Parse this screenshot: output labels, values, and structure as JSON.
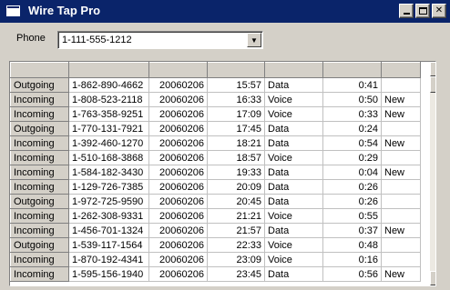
{
  "window": {
    "title": "Wire Tap Pro",
    "icons": {
      "minimize": "minimize-icon",
      "maximize": "maximize-icon",
      "close": "close-icon",
      "close_glyph": "✕"
    }
  },
  "phone": {
    "label": "Phone",
    "value": "1-111-555-1212",
    "dropdown_glyph": "▼"
  },
  "grid": {
    "headers": [
      "",
      "",
      "",
      "",
      "",
      "",
      ""
    ],
    "rows": [
      {
        "dir": "Outgoing",
        "number": "1-862-890-4662",
        "date": "20060206",
        "time": "15:57",
        "type": "Data",
        "duration": "0:41",
        "flag": ""
      },
      {
        "dir": "Incoming",
        "number": "1-808-523-2118",
        "date": "20060206",
        "time": "16:33",
        "type": "Voice",
        "duration": "0:50",
        "flag": "New"
      },
      {
        "dir": "Incoming",
        "number": "1-763-358-9251",
        "date": "20060206",
        "time": "17:09",
        "type": "Voice",
        "duration": "0:33",
        "flag": "New"
      },
      {
        "dir": "Outgoing",
        "number": "1-770-131-7921",
        "date": "20060206",
        "time": "17:45",
        "type": "Data",
        "duration": "0:24",
        "flag": ""
      },
      {
        "dir": "Incoming",
        "number": "1-392-460-1270",
        "date": "20060206",
        "time": "18:21",
        "type": "Data",
        "duration": "0:54",
        "flag": "New"
      },
      {
        "dir": "Incoming",
        "number": "1-510-168-3868",
        "date": "20060206",
        "time": "18:57",
        "type": "Voice",
        "duration": "0:29",
        "flag": ""
      },
      {
        "dir": "Incoming",
        "number": "1-584-182-3430",
        "date": "20060206",
        "time": "19:33",
        "type": "Data",
        "duration": "0:04",
        "flag": "New"
      },
      {
        "dir": "Incoming",
        "number": "1-129-726-7385",
        "date": "20060206",
        "time": "20:09",
        "type": "Data",
        "duration": "0:26",
        "flag": ""
      },
      {
        "dir": "Outgoing",
        "number": "1-972-725-9590",
        "date": "20060206",
        "time": "20:45",
        "type": "Data",
        "duration": "0:26",
        "flag": ""
      },
      {
        "dir": "Incoming",
        "number": "1-262-308-9331",
        "date": "20060206",
        "time": "21:21",
        "type": "Voice",
        "duration": "0:55",
        "flag": ""
      },
      {
        "dir": "Incoming",
        "number": "1-456-701-1324",
        "date": "20060206",
        "time": "21:57",
        "type": "Data",
        "duration": "0:37",
        "flag": "New"
      },
      {
        "dir": "Outgoing",
        "number": "1-539-117-1564",
        "date": "20060206",
        "time": "22:33",
        "type": "Voice",
        "duration": "0:48",
        "flag": ""
      },
      {
        "dir": "Incoming",
        "number": "1-870-192-4341",
        "date": "20060206",
        "time": "23:09",
        "type": "Voice",
        "duration": "0:16",
        "flag": ""
      },
      {
        "dir": "Incoming",
        "number": "1-595-156-1940",
        "date": "20060206",
        "time": "23:45",
        "type": "Data",
        "duration": "0:56",
        "flag": "New"
      }
    ]
  },
  "scrollbar": {
    "up_glyph": "▲",
    "down_glyph": "▼"
  },
  "colors": {
    "title_bar": "#0a246a",
    "face": "#d4d0c8",
    "grid_background": "#ffffff"
  }
}
